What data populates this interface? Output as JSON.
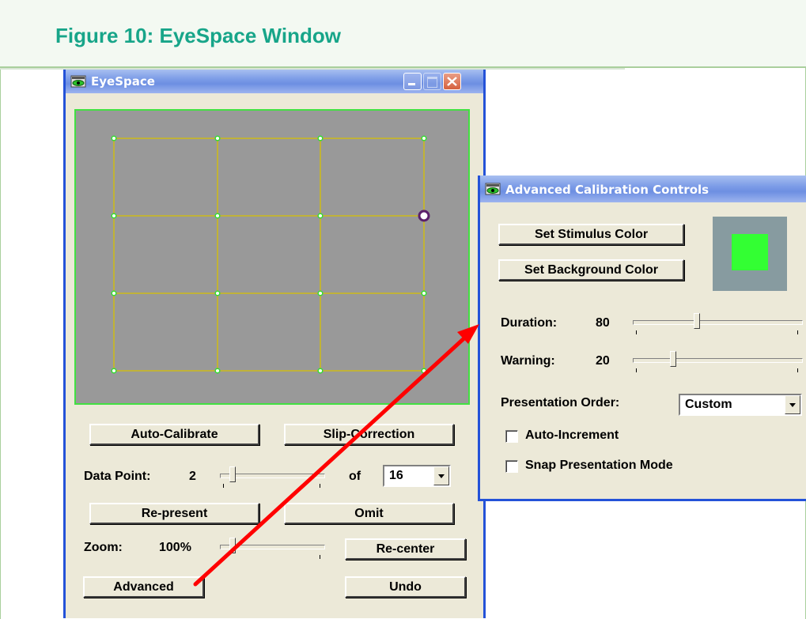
{
  "figure": {
    "title": "Figure 10: EyeSpace Window"
  },
  "eyespace": {
    "title": "EyeSpace",
    "calibration_grid": {
      "columns": 4,
      "rows": 4,
      "selected_point": 8
    },
    "buttons": {
      "auto_calibrate": "Auto-Calibrate",
      "slip_correction": "Slip-Correction",
      "re_present": "Re-present",
      "omit": "Omit",
      "re_center": "Re-center",
      "advanced": "Advanced",
      "undo": "Undo"
    },
    "data_point": {
      "label": "Data Point:",
      "value": "2",
      "of_label": "of",
      "total": "16"
    },
    "zoom": {
      "label": "Zoom:",
      "value": "100%"
    }
  },
  "advanced": {
    "title": "Advanced Calibration Controls",
    "buttons": {
      "stimulus_color": "Set Stimulus Color",
      "background_color": "Set Background Color"
    },
    "colors": {
      "stimulus": "#33ff33",
      "background": "#879ba0"
    },
    "duration": {
      "label": "Duration:",
      "value": "80"
    },
    "warning": {
      "label": "Warning:",
      "value": "20"
    },
    "presentation_order": {
      "label": "Presentation Order:",
      "value": "Custom"
    },
    "auto_increment": {
      "label": "Auto-Increment",
      "checked": false
    },
    "snap_mode": {
      "label": "Snap Presentation Mode",
      "checked": false
    }
  },
  "annotation": {
    "arrow_color": "#ff0000"
  }
}
